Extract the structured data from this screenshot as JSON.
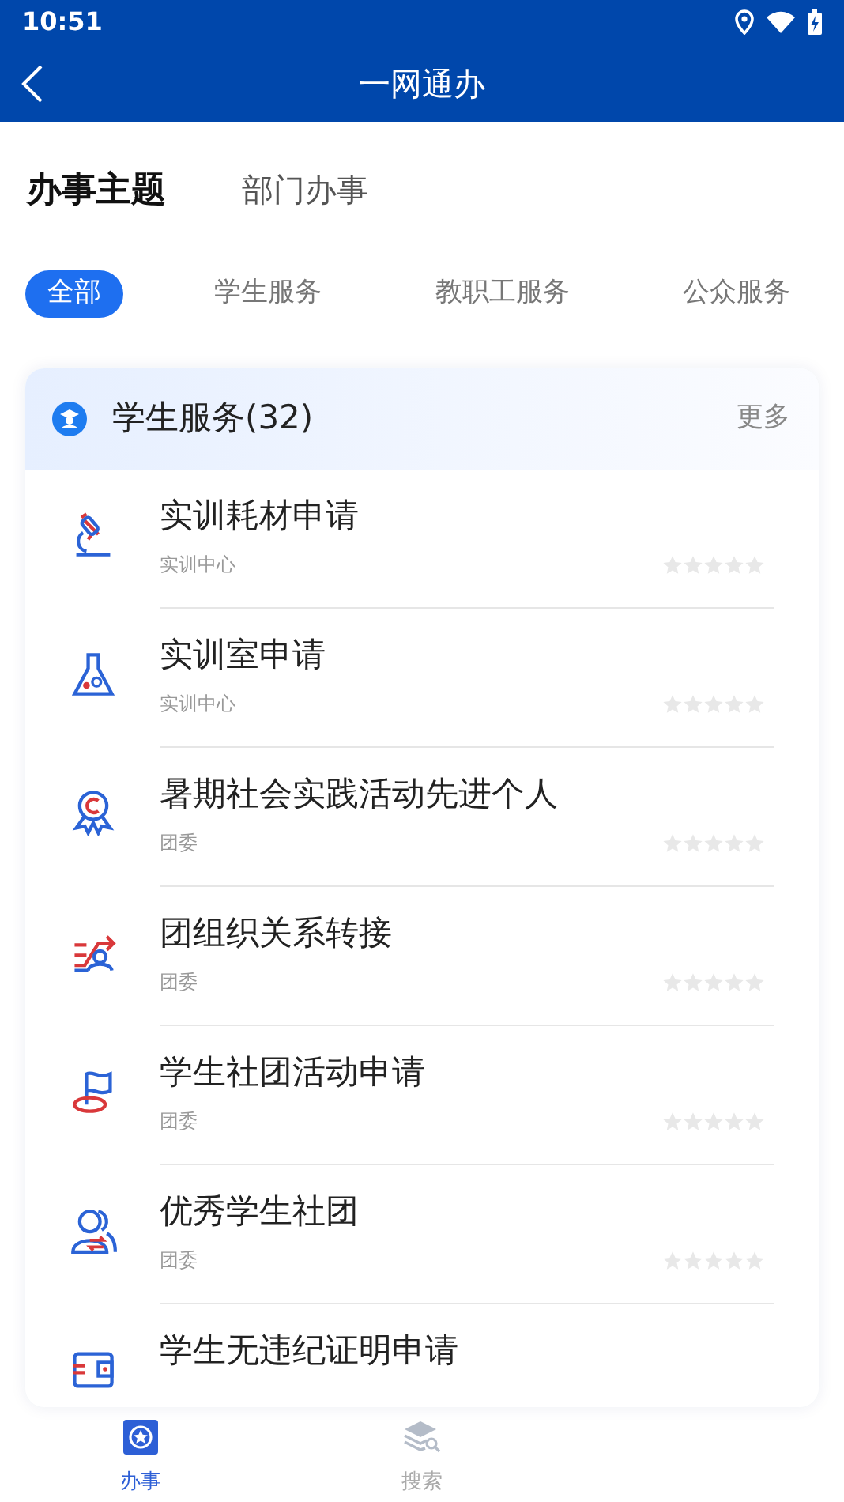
{
  "status_bar": {
    "time": "10:51"
  },
  "app_bar": {
    "title": "一网通办"
  },
  "main_tabs": [
    {
      "label": "办事主题",
      "selected": true
    },
    {
      "label": "部门办事",
      "selected": false
    }
  ],
  "filter_chips": [
    {
      "label": "全部",
      "selected": true
    },
    {
      "label": "学生服务",
      "selected": false
    },
    {
      "label": "教职工服务",
      "selected": false
    },
    {
      "label": "公众服务",
      "selected": false
    }
  ],
  "section": {
    "title": "学生服务(32)",
    "more": "更多"
  },
  "items": [
    {
      "title": "实训耗材申请",
      "department": "实训中心",
      "stars": 0
    },
    {
      "title": "实训室申请",
      "department": "实训中心",
      "stars": 0
    },
    {
      "title": "暑期社会实践活动先进个人",
      "department": "团委",
      "stars": 0
    },
    {
      "title": "团组织关系转接",
      "department": "团委",
      "stars": 0
    },
    {
      "title": "学生社团活动申请",
      "department": "团委",
      "stars": 0
    },
    {
      "title": "优秀学生社团",
      "department": "团委",
      "stars": 0
    },
    {
      "title": "学生无违纪证明申请"
    }
  ],
  "bottom_nav": [
    {
      "label": "办事",
      "selected": true
    },
    {
      "label": "搜索",
      "selected": false
    }
  ]
}
